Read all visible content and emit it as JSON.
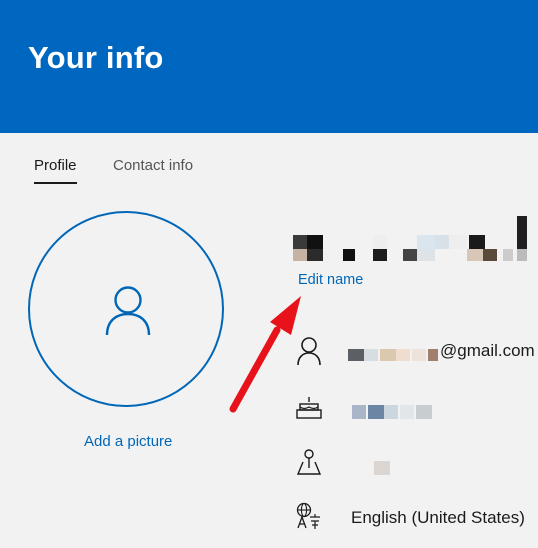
{
  "header": {
    "title": "Your info",
    "background": "#0067c0"
  },
  "tabs": [
    {
      "label": "Profile",
      "active": true
    },
    {
      "label": "Contact info",
      "active": false
    }
  ],
  "profile": {
    "add_picture_label": "Add a picture",
    "edit_name_label": "Edit name",
    "email_suffix": "@gmail.com",
    "language": "English (United States)"
  },
  "icons": {
    "avatar": "person-icon",
    "email": "person-icon",
    "birthday": "cake-icon",
    "region": "map-pin-icon",
    "language": "language-icon"
  },
  "colors": {
    "accent": "#0067b8",
    "annotation_arrow": "#e8121a"
  }
}
